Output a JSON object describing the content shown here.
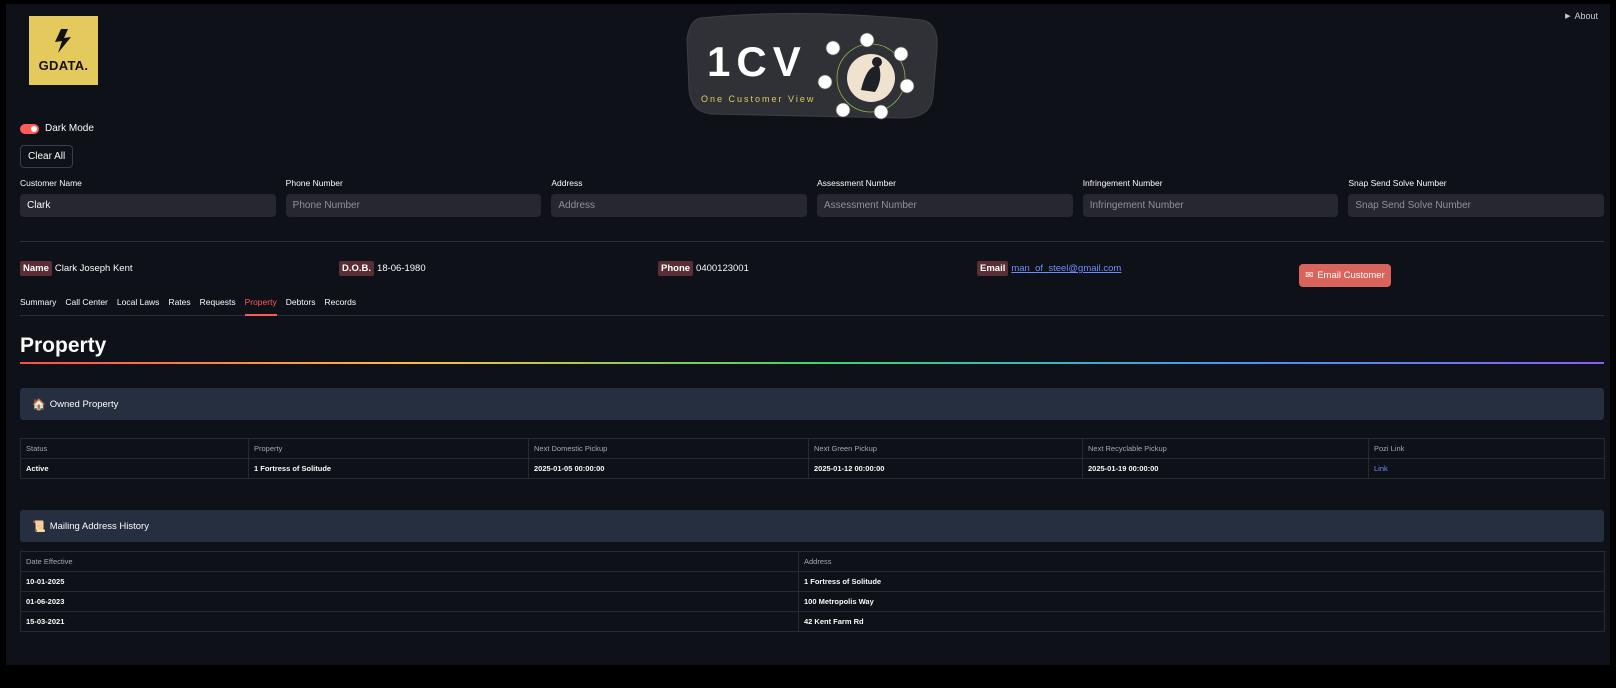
{
  "about_label": "About",
  "logos": {
    "gdata_text": "GDATA.",
    "onecv_title": "1CV",
    "onecv_subtitle": "One Customer View"
  },
  "dark_mode_label": "Dark Mode",
  "clear_all_label": "Clear All",
  "fields": [
    {
      "label": "Customer Name",
      "value": "Clark",
      "placeholder": "Customer Name"
    },
    {
      "label": "Phone Number",
      "value": "",
      "placeholder": "Phone Number"
    },
    {
      "label": "Address",
      "value": "",
      "placeholder": "Address"
    },
    {
      "label": "Assessment Number",
      "value": "",
      "placeholder": "Assessment Number"
    },
    {
      "label": "Infringement Number",
      "value": "",
      "placeholder": "Infringement Number"
    },
    {
      "label": "Snap Send Solve Number",
      "value": "",
      "placeholder": "Snap Send Solve Number"
    }
  ],
  "customer": {
    "name_label": "Name",
    "name": "Clark Joseph Kent",
    "dob_label": "D.O.B.",
    "dob": "18-06-1980",
    "phone_label": "Phone",
    "phone": "0400123001",
    "email_label": "Email",
    "email": "man_of_steel@gmail.com"
  },
  "email_button_label": "Email Customer",
  "tabs": [
    "Summary",
    "Call Center",
    "Local Laws",
    "Rates",
    "Requests",
    "Property",
    "Debtors",
    "Records"
  ],
  "active_tab": "Property",
  "page_title": "Property",
  "owned_property": {
    "heading": "Owned Property",
    "columns": [
      "Status",
      "Property",
      "Next Domestic Pickup",
      "Next Green Pickup",
      "Next Recyclable Pickup",
      "Pozi Link"
    ],
    "rows": [
      [
        "Active",
        "1 Fortress of Solitude",
        "2025-01-05 00:00:00",
        "2025-01-12 00:00:00",
        "2025-01-19 00:00:00",
        "Link"
      ]
    ]
  },
  "mailing_history": {
    "heading": "Mailing Address History",
    "columns": [
      "Date Effective",
      "Address"
    ],
    "rows": [
      [
        "10-01-2025",
        "1 Fortress of Solitude"
      ],
      [
        "01-06-2023",
        "100 Metropolis Way"
      ],
      [
        "15-03-2021",
        "42 Kent Farm Rd"
      ]
    ]
  },
  "colors": {
    "accent": "#ff5a5a",
    "background": "#0e1117",
    "input_bg": "#262730",
    "panel_bg": "#262f40",
    "logo_yellow": "#e4c95c",
    "link": "#6f8cff"
  }
}
